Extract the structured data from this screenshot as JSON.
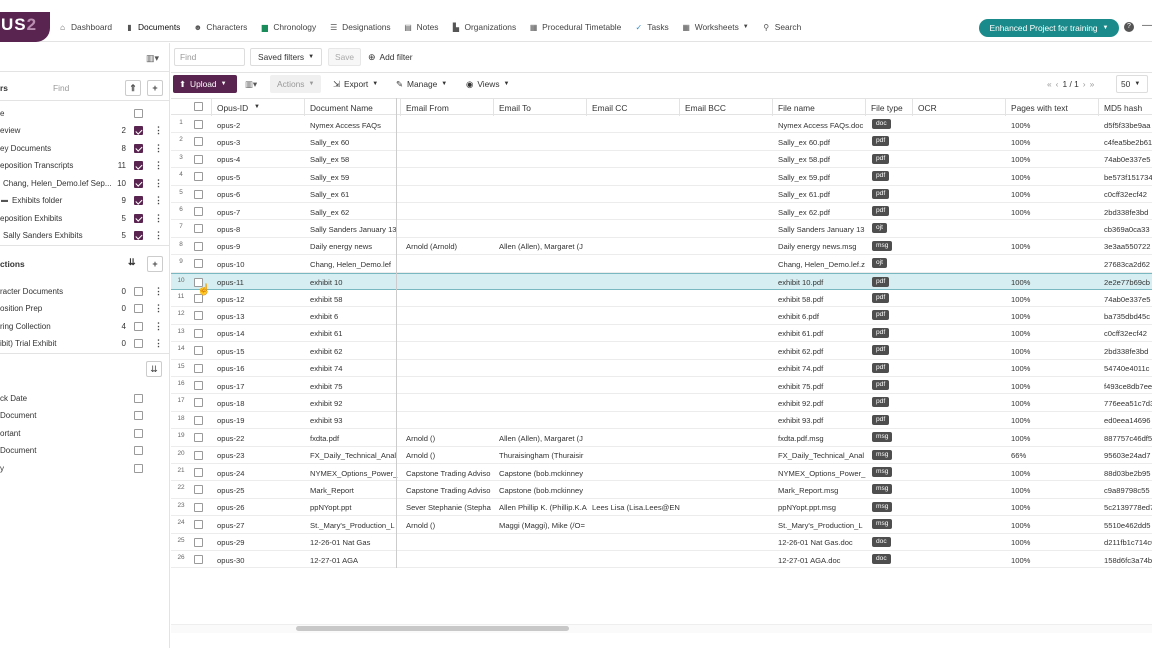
{
  "app": {
    "logo_main": "US",
    "logo_accent": "2"
  },
  "nav": [
    {
      "label": "Dashboard",
      "icon": "home-icon"
    },
    {
      "label": "Documents",
      "icon": "document-icon"
    },
    {
      "label": "Characters",
      "icon": "people-icon"
    },
    {
      "label": "Chronology",
      "icon": "calendar-icon"
    },
    {
      "label": "Designations",
      "icon": "list-icon"
    },
    {
      "label": "Notes",
      "icon": "note-icon"
    },
    {
      "label": "Organizations",
      "icon": "building-icon"
    },
    {
      "label": "Procedural Timetable",
      "icon": "timetable-icon"
    },
    {
      "label": "Tasks",
      "icon": "tasks-icon"
    },
    {
      "label": "Worksheets",
      "icon": "grid-icon"
    },
    {
      "label": "Search",
      "icon": "search-icon"
    }
  ],
  "project": {
    "label": "Enhanced Project for training"
  },
  "sidebar": {
    "section1_title": "rs",
    "find_placeholder": "Find",
    "folders": [
      {
        "label": "e",
        "count": "",
        "checked": false
      },
      {
        "label": "eview",
        "count": "2",
        "checked": true
      },
      {
        "label": "ey Documents",
        "count": "8",
        "checked": true
      },
      {
        "label": "eposition Transcripts",
        "count": "11",
        "checked": true
      },
      {
        "label": "Chang, Helen_Demo.lef Sep...",
        "count": "10",
        "checked": true
      },
      {
        "label": "Exhibits folder",
        "count": "9",
        "checked": true
      },
      {
        "label": "eposition Exhibits",
        "count": "5",
        "checked": true
      },
      {
        "label": "Sally Sanders Exhibits",
        "count": "5",
        "checked": true
      }
    ],
    "section2_title": "ctions",
    "collections": [
      {
        "label": "racter Documents",
        "count": "0"
      },
      {
        "label": "osition Prep",
        "count": "0"
      },
      {
        "label": "ring Collection",
        "count": "4"
      },
      {
        "label": "ibit) Trial Exhibit",
        "count": "0"
      }
    ],
    "tags": [
      {
        "label": "ck Date"
      },
      {
        "label": "Document"
      },
      {
        "label": "ortant"
      },
      {
        "label": "Document"
      },
      {
        "label": "y"
      }
    ]
  },
  "toolbar": {
    "find_placeholder": "Find",
    "saved_filters": "Saved filters",
    "save": "Save",
    "add_filter": "Add filter",
    "upload": "Upload",
    "actions": "Actions",
    "export": "Export",
    "manage": "Manage",
    "views": "Views",
    "page_info": "1 / 1",
    "page_size": "50"
  },
  "columns": [
    "Opus-ID",
    "Document Name",
    "Email From",
    "Email To",
    "Email CC",
    "Email BCC",
    "File name",
    "File type",
    "OCR",
    "Pages with text",
    "MD5 hash"
  ],
  "rows": [
    {
      "n": "1",
      "id": "opus-2",
      "name": "Nymex Access FAQs",
      "from": "",
      "to": "",
      "cc": "",
      "file": "Nymex Access FAQs.doc",
      "type": "doc",
      "pages": "100%",
      "md5": "d5f5f33be9aa"
    },
    {
      "n": "2",
      "id": "opus-3",
      "name": "Sally_ex 60",
      "from": "",
      "to": "",
      "cc": "",
      "file": "Sally_ex 60.pdf",
      "type": "pdf",
      "pages": "100%",
      "md5": "c4fea5be2b61"
    },
    {
      "n": "3",
      "id": "opus-4",
      "name": "Sally_ex 58",
      "from": "",
      "to": "",
      "cc": "",
      "file": "Sally_ex 58.pdf",
      "type": "pdf",
      "pages": "100%",
      "md5": "74ab0e337e5"
    },
    {
      "n": "4",
      "id": "opus-5",
      "name": "Sally_ex 59",
      "from": "",
      "to": "",
      "cc": "",
      "file": "Sally_ex 59.pdf",
      "type": "pdf",
      "pages": "100%",
      "md5": "be573f151734"
    },
    {
      "n": "5",
      "id": "opus-6",
      "name": "Sally_ex 61",
      "from": "",
      "to": "",
      "cc": "",
      "file": "Sally_ex 61.pdf",
      "type": "pdf",
      "pages": "100%",
      "md5": "c0cff32ecf42"
    },
    {
      "n": "6",
      "id": "opus-7",
      "name": "Sally_ex 62",
      "from": "",
      "to": "",
      "cc": "",
      "file": "Sally_ex 62.pdf",
      "type": "pdf",
      "pages": "100%",
      "md5": "2bd338fe3bd"
    },
    {
      "n": "7",
      "id": "opus-8",
      "name": "Sally Sanders January 13",
      "from": "",
      "to": "",
      "cc": "",
      "file": "Sally Sanders January 13",
      "type": "ojt",
      "pages": "",
      "md5": "cb369a0ca33"
    },
    {
      "n": "8",
      "id": "opus-9",
      "name": "Daily energy news",
      "from": "Arnold (Arnold)",
      "to": "Allen (Allen), Margaret (J",
      "cc": "",
      "file": "Daily energy news.msg",
      "type": "msg",
      "pages": "100%",
      "md5": "3e3aa550722"
    },
    {
      "n": "9",
      "id": "opus-10",
      "name": "Chang, Helen_Demo.lef",
      "from": "",
      "to": "",
      "cc": "",
      "file": "Chang, Helen_Demo.lef.z",
      "type": "ojt",
      "pages": "",
      "md5": "27683ca2d62"
    },
    {
      "n": "10",
      "id": "opus-11",
      "name": "exhibit 10",
      "from": "",
      "to": "",
      "cc": "",
      "file": "exhibit 10.pdf",
      "type": "pdf",
      "pages": "100%",
      "md5": "2e2e77b69cb"
    },
    {
      "n": "11",
      "id": "opus-12",
      "name": "exhibit 58",
      "from": "",
      "to": "",
      "cc": "",
      "file": "exhibit 58.pdf",
      "type": "pdf",
      "pages": "100%",
      "md5": "74ab0e337e5"
    },
    {
      "n": "12",
      "id": "opus-13",
      "name": "exhibit 6",
      "from": "",
      "to": "",
      "cc": "",
      "file": "exhibit 6.pdf",
      "type": "pdf",
      "pages": "100%",
      "md5": "ba735dbd45c"
    },
    {
      "n": "13",
      "id": "opus-14",
      "name": "exhibit 61",
      "from": "",
      "to": "",
      "cc": "",
      "file": "exhibit 61.pdf",
      "type": "pdf",
      "pages": "100%",
      "md5": "c0cff32ecf42"
    },
    {
      "n": "14",
      "id": "opus-15",
      "name": "exhibit 62",
      "from": "",
      "to": "",
      "cc": "",
      "file": "exhibit 62.pdf",
      "type": "pdf",
      "pages": "100%",
      "md5": "2bd338fe3bd"
    },
    {
      "n": "15",
      "id": "opus-16",
      "name": "exhibit 74",
      "from": "",
      "to": "",
      "cc": "",
      "file": "exhibit 74.pdf",
      "type": "pdf",
      "pages": "100%",
      "md5": "54740e4011c"
    },
    {
      "n": "16",
      "id": "opus-17",
      "name": "exhibit 75",
      "from": "",
      "to": "",
      "cc": "",
      "file": "exhibit 75.pdf",
      "type": "pdf",
      "pages": "100%",
      "md5": "f493ce8db7ee"
    },
    {
      "n": "17",
      "id": "opus-18",
      "name": "exhibit 92",
      "from": "",
      "to": "",
      "cc": "",
      "file": "exhibit 92.pdf",
      "type": "pdf",
      "pages": "100%",
      "md5": "776eea51c7d3"
    },
    {
      "n": "18",
      "id": "opus-19",
      "name": "exhibit 93",
      "from": "",
      "to": "",
      "cc": "",
      "file": "exhibit 93.pdf",
      "type": "pdf",
      "pages": "100%",
      "md5": "ed0eea14696"
    },
    {
      "n": "19",
      "id": "opus-22",
      "name": "fxdta.pdf",
      "from": "Arnold ()",
      "to": "Allen (Allen), Margaret (J",
      "cc": "",
      "file": "fxdta.pdf.msg",
      "type": "msg",
      "pages": "100%",
      "md5": "887757c46df5"
    },
    {
      "n": "20",
      "id": "opus-23",
      "name": "FX_Daily_Technical_Anal",
      "from": "Arnold ()",
      "to": "Thuraisingham (Thuraisir",
      "cc": "",
      "file": "FX_Daily_Technical_Anal",
      "type": "msg",
      "pages": "66%",
      "md5": "95603e24ad7"
    },
    {
      "n": "21",
      "id": "opus-24",
      "name": "NYMEX_Options_Power_",
      "from": "Capstone Trading Adviso",
      "to": "Capstone (bob.mckinney",
      "cc": "",
      "file": "NYMEX_Options_Power_",
      "type": "msg",
      "pages": "100%",
      "md5": "88d03be2b95"
    },
    {
      "n": "22",
      "id": "opus-25",
      "name": "Mark_Report",
      "from": "Capstone Trading Adviso",
      "to": "Capstone (bob.mckinney",
      "cc": "",
      "file": "Mark_Report.msg",
      "type": "msg",
      "pages": "100%",
      "md5": "c9a89798c55"
    },
    {
      "n": "23",
      "id": "opus-26",
      "name": "ppNYopt.ppt",
      "from": "Sever Stephanie (Stepha",
      "to": "Allen Phillip K. (Phillip.K.A",
      "cc": "Lees Lisa (Lisa.Lees@EN",
      "file": "ppNYopt.ppt.msg",
      "type": "msg",
      "pages": "100%",
      "md5": "5c2139778ed7"
    },
    {
      "n": "24",
      "id": "opus-27",
      "name": "St._Mary's_Production_L",
      "from": "Arnold ()",
      "to": "Maggi (Maggi), Mike (/O=",
      "cc": "",
      "file": "St._Mary's_Production_L",
      "type": "msg",
      "pages": "100%",
      "md5": "5510e462dd5"
    },
    {
      "n": "25",
      "id": "opus-29",
      "name": "12-26-01 Nat Gas",
      "from": "",
      "to": "",
      "cc": "",
      "file": "12-26-01 Nat Gas.doc",
      "type": "doc",
      "pages": "100%",
      "md5": "d211fb1c714c6"
    },
    {
      "n": "26",
      "id": "opus-30",
      "name": "12-27-01 AGA",
      "from": "",
      "to": "",
      "cc": "",
      "file": "12-27-01 AGA.doc",
      "type": "doc",
      "pages": "100%",
      "md5": "158d6fc3a74b"
    }
  ],
  "highlighted_row": "10"
}
